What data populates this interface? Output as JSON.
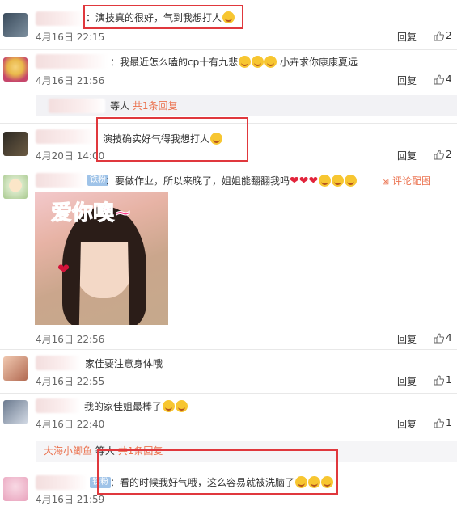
{
  "comments": [
    {
      "text": "：演技真的很好，气到我想打人",
      "emoji_count": 1,
      "time": "4月16日 22:15",
      "reply": "回复",
      "likes": "2"
    },
    {
      "text": "：我最近怎么嗑的cp十有九悲",
      "text2": "小卉求你康康夏远",
      "emoji_count": 3,
      "time": "4月16日 21:56",
      "reply": "回复",
      "likes": "4"
    },
    {
      "text": "演技确实好气得我想打人",
      "emoji_count": 1,
      "time": "4月20日 14:00",
      "reply": "回复",
      "likes": "2"
    },
    {
      "badge": "铁粉",
      "text": "：要做作业，所以来晚了，姐姐能翻翻我吗",
      "emoji_count": 3,
      "heart_count": 3,
      "time": "4月16日 22:56",
      "reply": "回复",
      "likes": "4",
      "comment_image": "评论配图",
      "image_text": "爱你噢~"
    },
    {
      "text": "家佳要注意身体哦",
      "time": "4月16日 22:55",
      "reply": "回复",
      "likes": "1"
    },
    {
      "text": "我的家佳姐最棒了",
      "emoji_count": 2,
      "time": "4月16日 22:40",
      "reply": "回复",
      "likes": "1"
    },
    {
      "badge": "铁粉",
      "text": "：看的时候我好气哦，这么容易就被洗脑了",
      "emoji_count": 3,
      "time": "4月16日 21:59",
      "reply": "回复",
      "likes": ""
    }
  ],
  "reply_bars": [
    {
      "prefix": "等人",
      "count_link": "共1条回复"
    },
    {
      "user": "大海小鲫鱼",
      "prefix": "等人",
      "count_link": "共1条回复"
    }
  ],
  "colors": {
    "highlight": "#e0383d",
    "link": "#eb7350",
    "badge": "#9fc3e8"
  }
}
